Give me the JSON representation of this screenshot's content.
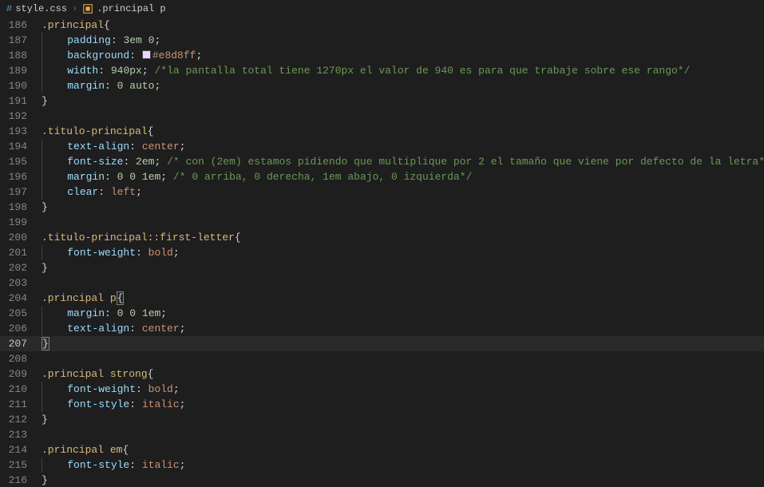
{
  "breadcrumb": {
    "file": "style.css",
    "selector": ".principal p"
  },
  "lines": [
    {
      "num": "186",
      "html": "<span class='sel'>.principal</span><span class='punc'>{</span>"
    },
    {
      "num": "187",
      "html": "    <span class='prop'>padding</span><span class='punc'>: </span><span class='num'>3em</span> <span class='num'>0</span><span class='punc'>;</span>",
      "indent": 1
    },
    {
      "num": "188",
      "html": "    <span class='prop'>background</span><span class='punc'>: </span><span class='swatch'></span><span class='str'>#e8d8ff</span><span class='punc'>;</span>",
      "indent": 1
    },
    {
      "num": "189",
      "html": "    <span class='prop'>width</span><span class='punc'>: </span><span class='num'>940px</span><span class='punc'>;</span> <span class='comm'>/*la pantalla total tiene 1270px el valor de 940 es para que trabaje sobre ese rango*/</span>",
      "indent": 1
    },
    {
      "num": "190",
      "html": "    <span class='prop'>margin</span><span class='punc'>: </span><span class='num'>0</span> <span class='num'>auto</span><span class='punc'>;</span>",
      "indent": 1
    },
    {
      "num": "191",
      "html": "<span class='punc'>}</span>"
    },
    {
      "num": "192",
      "html": ""
    },
    {
      "num": "193",
      "html": "<span class='sel'>.titulo-principal</span><span class='punc'>{</span>"
    },
    {
      "num": "194",
      "html": "    <span class='prop'>text-align</span><span class='punc'>: </span><span class='str'>center</span><span class='punc'>;</span>",
      "indent": 1
    },
    {
      "num": "195",
      "html": "    <span class='prop'>font-size</span><span class='punc'>: </span><span class='num'>2em</span><span class='punc'>;</span> <span class='comm'>/* con (2em) estamos pidiendo que multiplique por 2 el tamaño que viene por defecto de la letra*</span>",
      "indent": 1
    },
    {
      "num": "196",
      "html": "    <span class='prop'>margin</span><span class='punc'>: </span><span class='num'>0</span> <span class='num'>0</span> <span class='num'>1em</span><span class='punc'>;</span> <span class='comm'>/* 0 arriba, 0 derecha, 1em abajo, 0 izquierda*/</span>",
      "indent": 1
    },
    {
      "num": "197",
      "html": "    <span class='prop'>clear</span><span class='punc'>: </span><span class='str'>left</span><span class='punc'>;</span>",
      "indent": 1
    },
    {
      "num": "198",
      "html": "<span class='punc'>}</span>"
    },
    {
      "num": "199",
      "html": ""
    },
    {
      "num": "200",
      "html": "<span class='sel'>.titulo-principal</span><span class='pseudo'>::first-letter</span><span class='punc'>{</span>"
    },
    {
      "num": "201",
      "html": "    <span class='prop'>font-weight</span><span class='punc'>: </span><span class='str'>bold</span><span class='punc'>;</span>",
      "indent": 1
    },
    {
      "num": "202",
      "html": "<span class='punc'>}</span>"
    },
    {
      "num": "203",
      "html": ""
    },
    {
      "num": "204",
      "html": "<span class='sel'>.principal</span> <span class='sel'>p</span><span class='punc cursor-box'>{</span>"
    },
    {
      "num": "205",
      "html": "    <span class='prop'>margin</span><span class='punc'>: </span><span class='num'>0</span> <span class='num'>0</span> <span class='num'>1em</span><span class='punc'>;</span>",
      "indent": 1
    },
    {
      "num": "206",
      "html": "    <span class='prop'>text-align</span><span class='punc'>: </span><span class='str'>center</span><span class='punc'>;</span>",
      "indent": 1
    },
    {
      "num": "207",
      "html": "<span class='punc cursor-box'>}</span>",
      "current": true
    },
    {
      "num": "208",
      "html": ""
    },
    {
      "num": "209",
      "html": "<span class='sel'>.principal</span> <span class='sel'>strong</span><span class='punc'>{</span>"
    },
    {
      "num": "210",
      "html": "    <span class='prop'>font-weight</span><span class='punc'>: </span><span class='str'>bold</span><span class='punc'>;</span>",
      "indent": 1
    },
    {
      "num": "211",
      "html": "    <span class='prop'>font-style</span><span class='punc'>: </span><span class='str'>italic</span><span class='punc'>;</span>",
      "indent": 1
    },
    {
      "num": "212",
      "html": "<span class='punc'>}</span>"
    },
    {
      "num": "213",
      "html": ""
    },
    {
      "num": "214",
      "html": "<span class='sel'>.principal</span> <span class='sel'>em</span><span class='punc'>{</span>"
    },
    {
      "num": "215",
      "html": "    <span class='prop'>font-style</span><span class='punc'>: </span><span class='str'>italic</span><span class='punc'>;</span>",
      "indent": 1
    },
    {
      "num": "216",
      "html": "<span class='punc'>}</span>"
    }
  ]
}
